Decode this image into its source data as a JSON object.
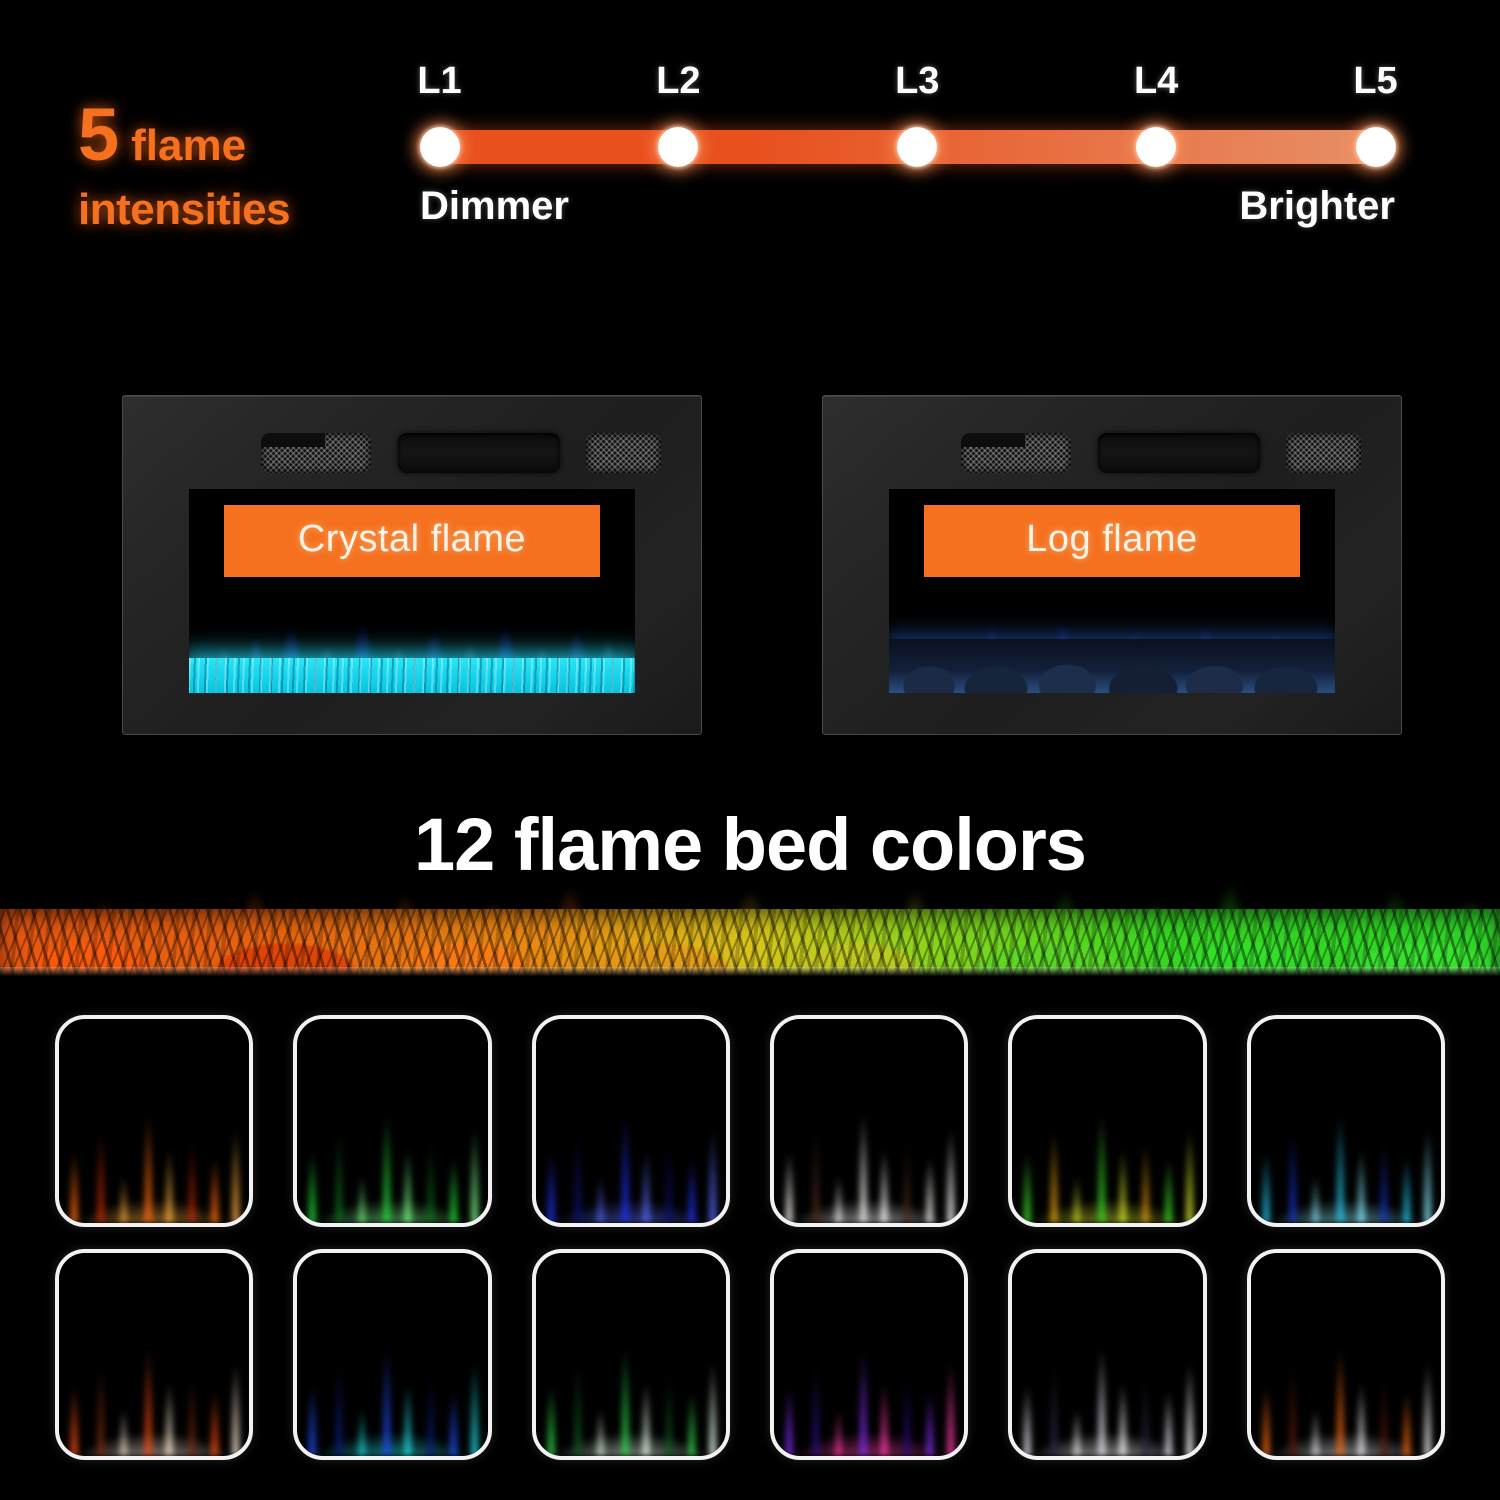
{
  "intensity": {
    "heading_number": "5",
    "heading_word": "flame",
    "heading_line2": "intensities",
    "ticks": [
      "L1",
      "L2",
      "L3",
      "L4",
      "L5"
    ],
    "left_label": "Dimmer",
    "right_label": "Brighter",
    "track_start_color": "#E8501E",
    "track_end_color": "#E79169",
    "accent_color": "#F5711F"
  },
  "units": [
    {
      "name": "crystal",
      "caption": "Crystal flame",
      "bed": "crystal",
      "flame_color": "#2A55FF"
    },
    {
      "name": "log",
      "caption": "Log flame",
      "bed": "log",
      "flame_color": "#2A9CFF"
    }
  ],
  "banner": {
    "title": "12 flame bed colors",
    "gradient_start": "#E8560F",
    "gradient_mid": "#D8C41A",
    "gradient_end": "#2ED428"
  },
  "swatches": [
    {
      "label": "orange",
      "c1": "#FF6A10",
      "c2": "#C22A05",
      "c3": "#FFB040"
    },
    {
      "label": "green",
      "c1": "#23D93A",
      "c2": "#0B6F1A",
      "c3": "#7BFF8C"
    },
    {
      "label": "blue",
      "c1": "#2030F0",
      "c2": "#0A1170",
      "c3": "#5A6BFF"
    },
    {
      "label": "warm-white",
      "c1": "#F2EDE6",
      "c2": "#4A2A18",
      "c3": "#FFFFFF"
    },
    {
      "label": "green-orange",
      "c1": "#3CD827",
      "c2": "#E8A214",
      "c3": "#D8E82A"
    },
    {
      "label": "cyan-blue",
      "c1": "#26C4E8",
      "c2": "#1633C8",
      "c3": "#8CEFFF"
    },
    {
      "label": "orange-white",
      "c1": "#F04A14",
      "c2": "#7A2A10",
      "c3": "#FFE9D6"
    },
    {
      "label": "blue-cyan",
      "c1": "#1F4CF0",
      "c2": "#0A1E80",
      "c3": "#22E2E8"
    },
    {
      "label": "green-white",
      "c1": "#2FD44A",
      "c2": "#0E5A1E",
      "c3": "#E8FFEA"
    },
    {
      "label": "purple-pink",
      "c1": "#7B2CE8",
      "c2": "#2A0E80",
      "c3": "#FF3FA8"
    },
    {
      "label": "silver-white",
      "c1": "#E0E0EE",
      "c2": "#2A2A44",
      "c3": "#FFFFFF"
    },
    {
      "label": "orange-silver",
      "c1": "#F06A14",
      "c2": "#5A1A0A",
      "c3": "#EFEFF6"
    }
  ]
}
